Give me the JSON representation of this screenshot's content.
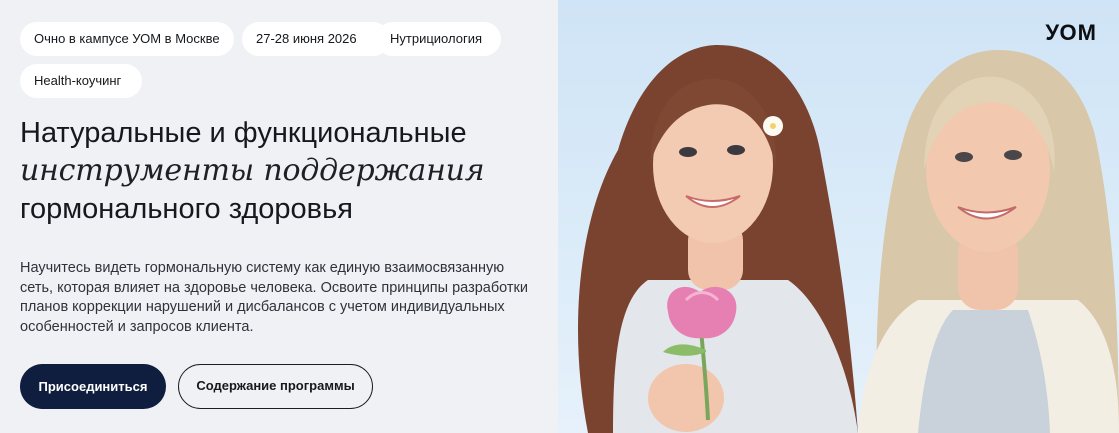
{
  "tags": [
    {
      "label": "Очно в кампусе УОМ в Москве"
    },
    {
      "label": "27-28 июня 2026"
    },
    {
      "label": "Нутрициология"
    },
    {
      "label": "Health-коучинг"
    }
  ],
  "hero": {
    "title_line1": "Натуральные и функциональные",
    "title_line2": "инструменты поддержания",
    "title_line3": "гормонального здоровья",
    "description": "Научитесь видеть гормональную систему как единую взаимосвязанную сеть, которая влияет на здоровье человека. Освоите принципы разработки планов коррекции нарушений и дисбалансов с учетом индивидуальных особенностей и запросов клиента.",
    "primary_button": "Присоединиться",
    "secondary_button": "Содержание программы"
  },
  "brand": {
    "logo": "УОМ"
  },
  "colors": {
    "primary_button_bg": "#0f1d3f",
    "image_bg": "#d4e7f7"
  }
}
